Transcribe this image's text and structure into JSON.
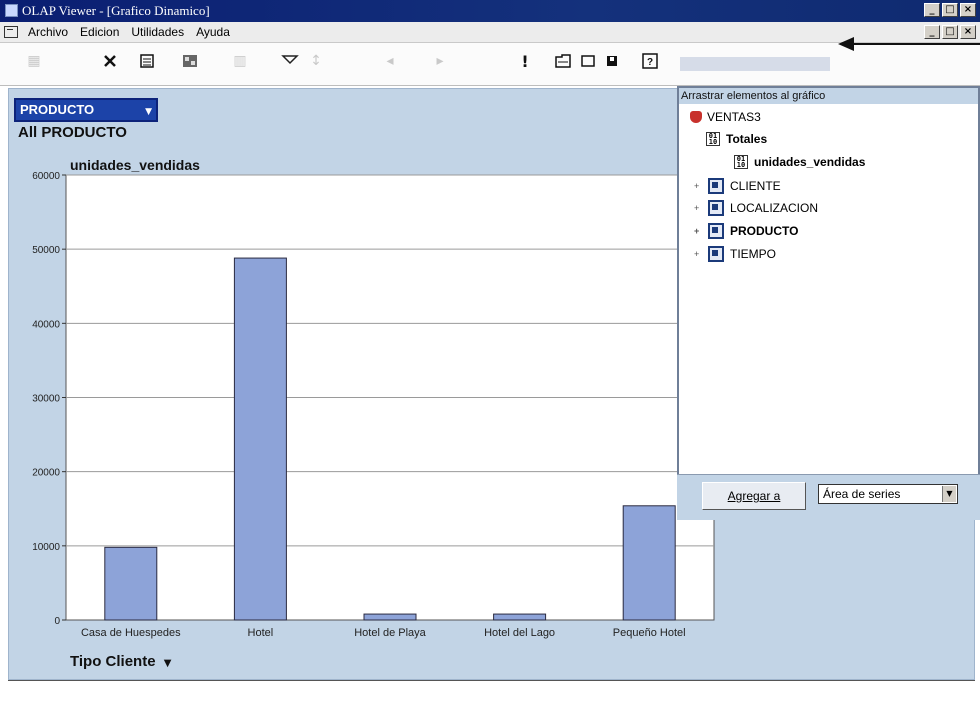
{
  "window": {
    "title": "OLAP Viewer - [Grafico Dinamico]",
    "controls": [
      "_",
      "□",
      "×"
    ]
  },
  "menu": {
    "items": [
      "Archivo",
      "Edicion",
      "Utilidades",
      "Ayuda"
    ]
  },
  "toolbar": {
    "icons": [
      "grid-icon",
      "delete-icon",
      "properties-icon",
      "chart-type-icon",
      "filter-icon",
      "sort-icon",
      "field-list-icon",
      "add-chart-icon",
      "pivot-icon",
      "help-icon"
    ]
  },
  "chart_pane": {
    "filter_field": "PRODUCTO",
    "filter_value": "All PRODUCTO",
    "category_field": "Tipo Cliente"
  },
  "chart_data": {
    "type": "bar",
    "title": "unidades_vendidas",
    "categories": [
      "Casa de Huespedes",
      "Hotel",
      "Hotel de Playa",
      "Hotel del Lago",
      "Pequeño Hotel"
    ],
    "values": [
      9800,
      48800,
      800,
      800,
      15400
    ],
    "yticks": [
      0,
      10000,
      20000,
      30000,
      40000,
      50000,
      60000
    ],
    "ytick_labels": [
      "0",
      "10000",
      "20000",
      "30000",
      "40000",
      "50000",
      "60000"
    ],
    "ylim": [
      0,
      60000
    ],
    "bar_color": "#8da3d8",
    "grid": true
  },
  "field_list": {
    "header": "Arrastrar elementos al gráfico",
    "cube": "VENTAS3",
    "totals_label": "Totales",
    "measure": "unidades_vendidas",
    "dimensions": [
      "CLIENTE",
      "LOCALIZACION",
      "PRODUCTO",
      "TIEMPO"
    ],
    "add_button": "Agregar a",
    "area_value": "Área de series"
  }
}
